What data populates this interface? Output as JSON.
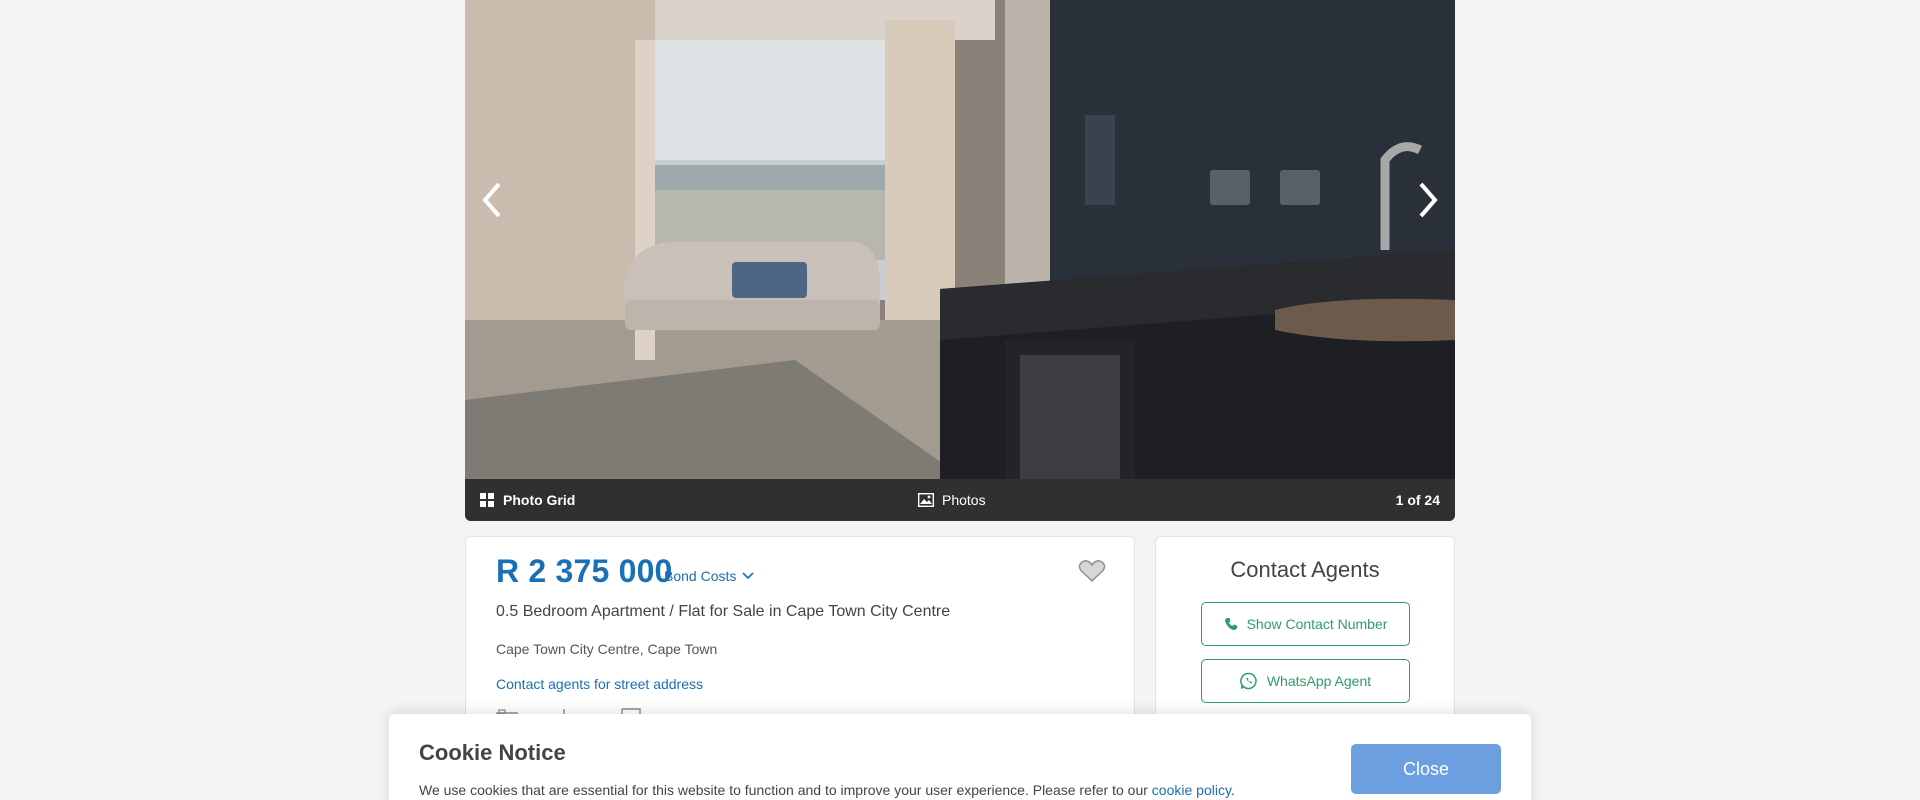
{
  "gallery": {
    "photo_grid_label": "Photo Grid",
    "photos_label": "Photos",
    "counter": "1 of 24",
    "prev_icon": "chevron-left-icon",
    "next_icon": "chevron-right-icon"
  },
  "listing": {
    "price": "R 2 375 000",
    "bond_costs_label": "Bond Costs",
    "title": "0.5 Bedroom Apartment / Flat for Sale in Cape Town City Centre",
    "location": "Cape Town City Centre, Cape Town",
    "street_address_link": "Contact agents for street address",
    "feature_icons": [
      "bedroom-icon",
      "bathroom-icon",
      "floor-size-icon"
    ]
  },
  "contact": {
    "title": "Contact Agents",
    "show_number_label": "Show Contact Number",
    "whatsapp_label": "WhatsApp Agent"
  },
  "cookie": {
    "title": "Cookie Notice",
    "text_before": "We use cookies that are essential for this website to function and to improve your user experience. Please refer to our ",
    "link": "cookie policy",
    "text_after": ".",
    "close_label": "Close"
  },
  "colors": {
    "price_blue": "#1a6fb5",
    "agent_green": "#2e9e67",
    "close_button": "#6b9fe0",
    "gallery_bar": "#303030"
  }
}
